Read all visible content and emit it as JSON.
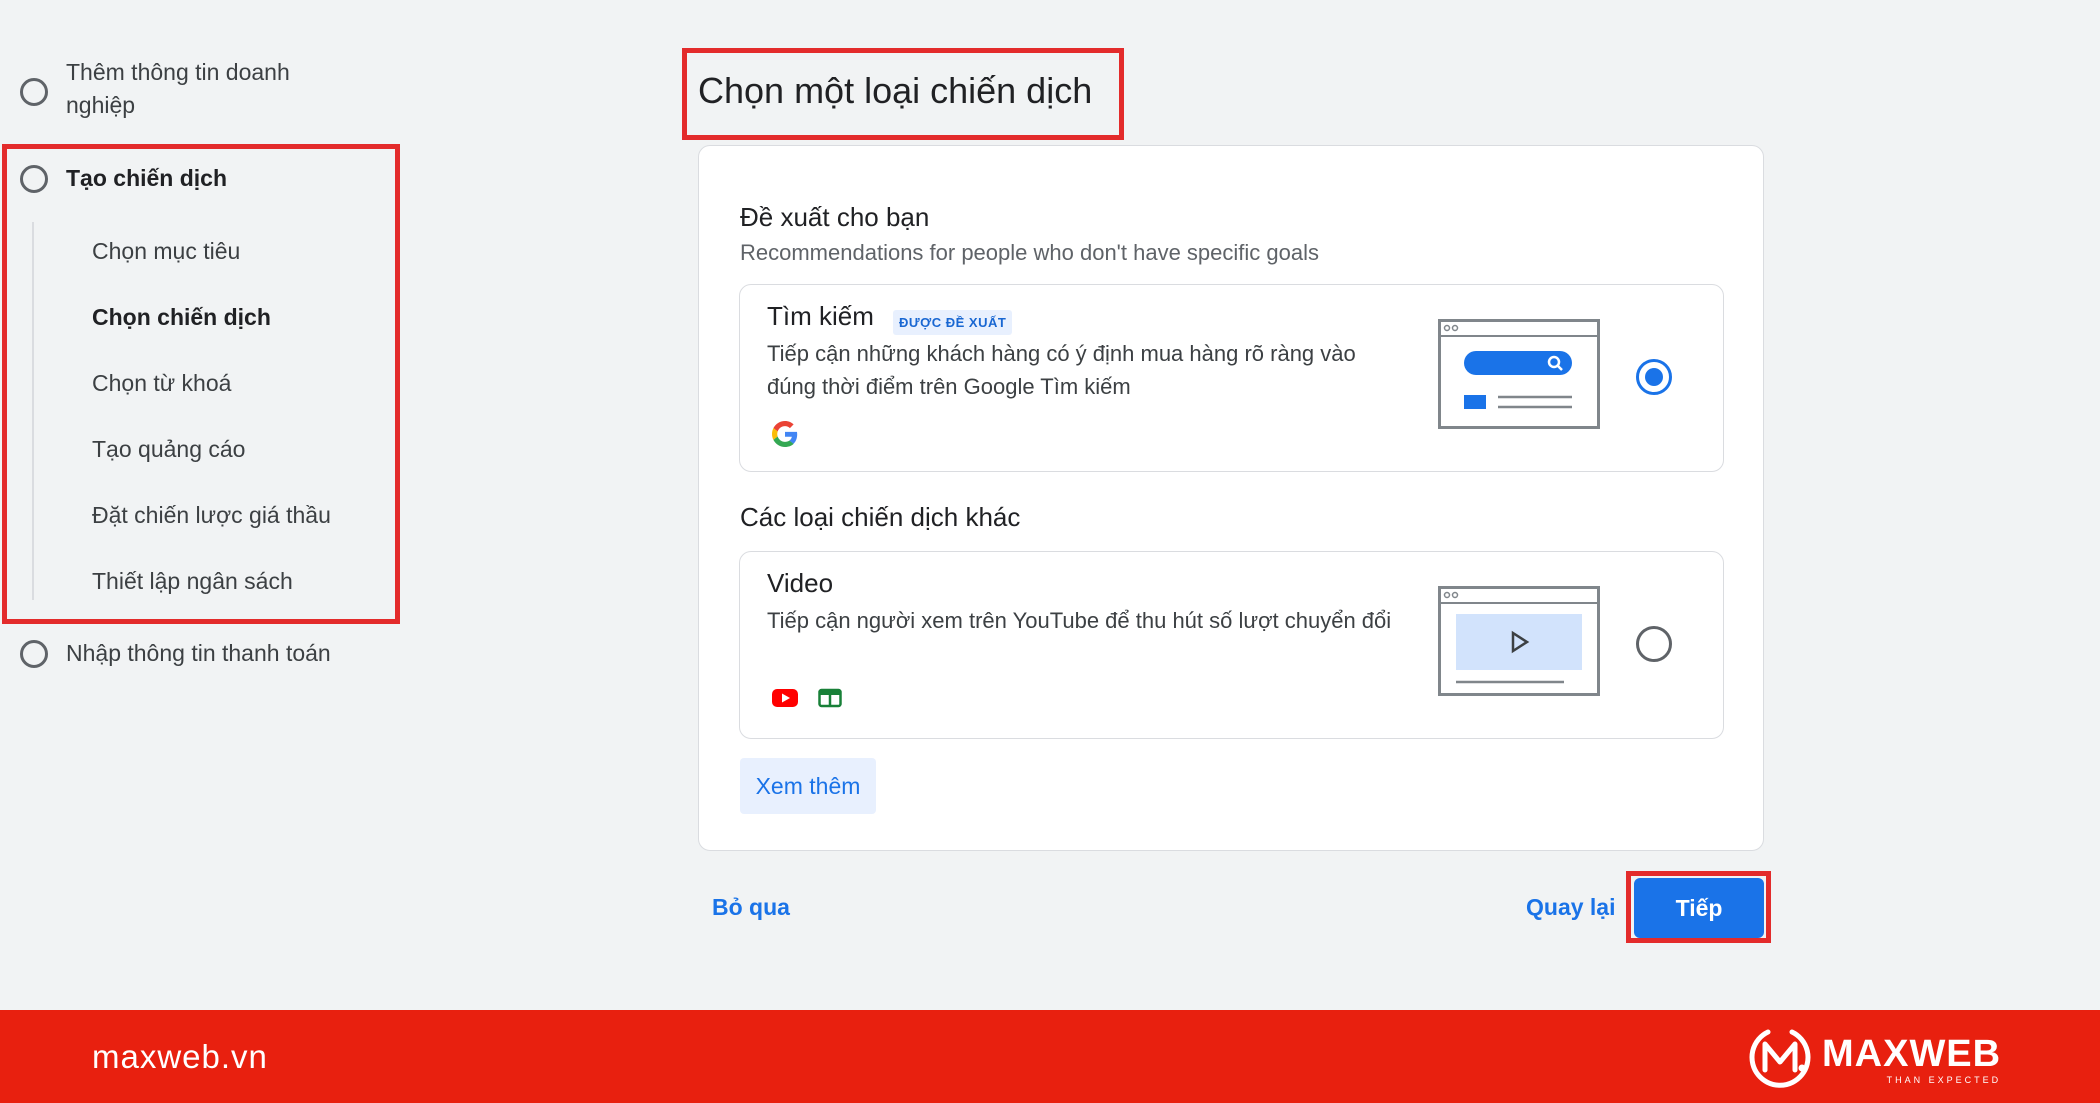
{
  "sidebar": {
    "steps": [
      {
        "label": "Thêm thông tin doanh nghiệp"
      },
      {
        "label": "Tạo chiến dịch"
      },
      {
        "label": "Nhập thông tin thanh toán"
      }
    ],
    "substeps": [
      {
        "label": "Chọn mục tiêu"
      },
      {
        "label": "Chọn chiến dịch"
      },
      {
        "label": "Chọn từ khoá"
      },
      {
        "label": "Tạo quảng cáo"
      },
      {
        "label": "Đặt chiến lược giá thầu"
      },
      {
        "label": "Thiết lập ngân sách"
      }
    ],
    "active_substep": "Chọn chiến dịch"
  },
  "main": {
    "title": "Chọn một loại chiến dịch",
    "recommended": {
      "title": "Đề xuất cho bạn",
      "subtitle": "Recommendations for people who don't have specific goals",
      "option": {
        "title": "Tìm kiếm",
        "badge": "ĐƯỢC ĐỀ XUẤT",
        "description": "Tiếp cận những khách hàng có ý định mua hàng rõ ràng vào đúng thời điểm trên Google Tìm kiếm",
        "selected": true,
        "icons": [
          "google-icon"
        ]
      }
    },
    "other": {
      "title": "Các loại chiến dịch khác",
      "option": {
        "title": "Video",
        "description": "Tiếp cận người xem trên YouTube để thu hút số lượt chuyển đổi",
        "selected": false,
        "icons": [
          "youtube-icon",
          "google-sheets-icon"
        ]
      }
    },
    "see_more_label": "Xem thêm"
  },
  "footer": {
    "skip_label": "Bỏ qua",
    "back_label": "Quay lại",
    "next_label": "Tiếp"
  },
  "brand": {
    "url": "maxweb.vn",
    "name": "MAXWEB",
    "tagline": "THAN EXPECTED"
  },
  "colors": {
    "accent": "#1a73e8",
    "highlight_box": "#e32b2b",
    "brand_bar": "#e8200f",
    "background": "#f1f3f4"
  }
}
